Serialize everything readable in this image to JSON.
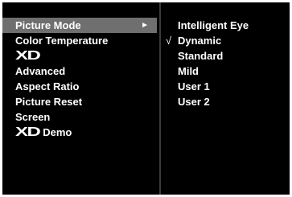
{
  "left_menu": {
    "items": [
      {
        "label": "Picture Mode",
        "has_submenu_arrow": true,
        "selected": true
      },
      {
        "label": "Color Temperature"
      },
      {
        "logo": "XD"
      },
      {
        "label": "Advanced"
      },
      {
        "label": "Aspect Ratio"
      },
      {
        "label": "Picture Reset"
      },
      {
        "label": "Screen"
      },
      {
        "logo": "XD",
        "label": "Demo"
      }
    ],
    "arrow_glyph": "►"
  },
  "right_menu": {
    "options": [
      {
        "label": "Intelligent Eye",
        "checked": false
      },
      {
        "label": "Dynamic",
        "checked": true
      },
      {
        "label": "Standard",
        "checked": false
      },
      {
        "label": "Mild",
        "checked": false
      },
      {
        "label": "User 1",
        "checked": false
      },
      {
        "label": "User 2",
        "checked": false
      }
    ],
    "check_glyph": "√"
  },
  "colors": {
    "background": "#000000",
    "selected_row": "#6f6f6f",
    "text": "#ffffff"
  }
}
